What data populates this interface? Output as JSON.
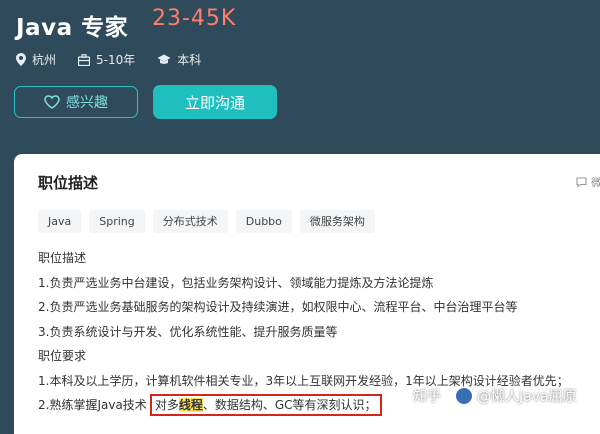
{
  "header": {
    "job_title": "Java 专家",
    "salary": "23-45K",
    "meta": {
      "location": "杭州",
      "experience": "5-10年",
      "education": "本科"
    },
    "interest_label": "感兴趣",
    "chat_label": "立即沟通"
  },
  "card": {
    "section_title": "职位描述",
    "side_hint": "微",
    "tags": [
      "Java",
      "Spring",
      "分布式技术",
      "Dubbo",
      "微服务架构"
    ],
    "lines": [
      "职位描述",
      "1.负责严选业务中台建设，包括业务架构设计、领域能力提炼及方法论提炼",
      "2.负责严选业务基础服务的架构设计及持续演进，如权限中心、流程平台、中台治理平台等",
      "3.负责系统设计与开发、优化系统性能、提升服务质量等",
      "职位要求",
      "1.本科及以上学历，计算机软件相关专业，3年以上互联网开发经验，1年以上架构设计经验者优先；"
    ],
    "last_line": {
      "prefix": "2.熟练掌握Java技术",
      "boxed_before": "对多",
      "boxed_highlight": "线程",
      "boxed_after": "、数据结构、GC等有深刻认识；"
    }
  },
  "watermark": {
    "left": "知乎",
    "author": "@懒人Java屈原"
  },
  "colors": {
    "background": "#2f4a5a",
    "salary": "#ff7f6b",
    "accent": "#1fbfc0",
    "highlight": "#ffe85a",
    "box_border": "#d6261c"
  },
  "icons": [
    "location-pin-icon",
    "briefcase-icon",
    "graduation-cap-icon",
    "heart-icon",
    "comment-icon"
  ]
}
